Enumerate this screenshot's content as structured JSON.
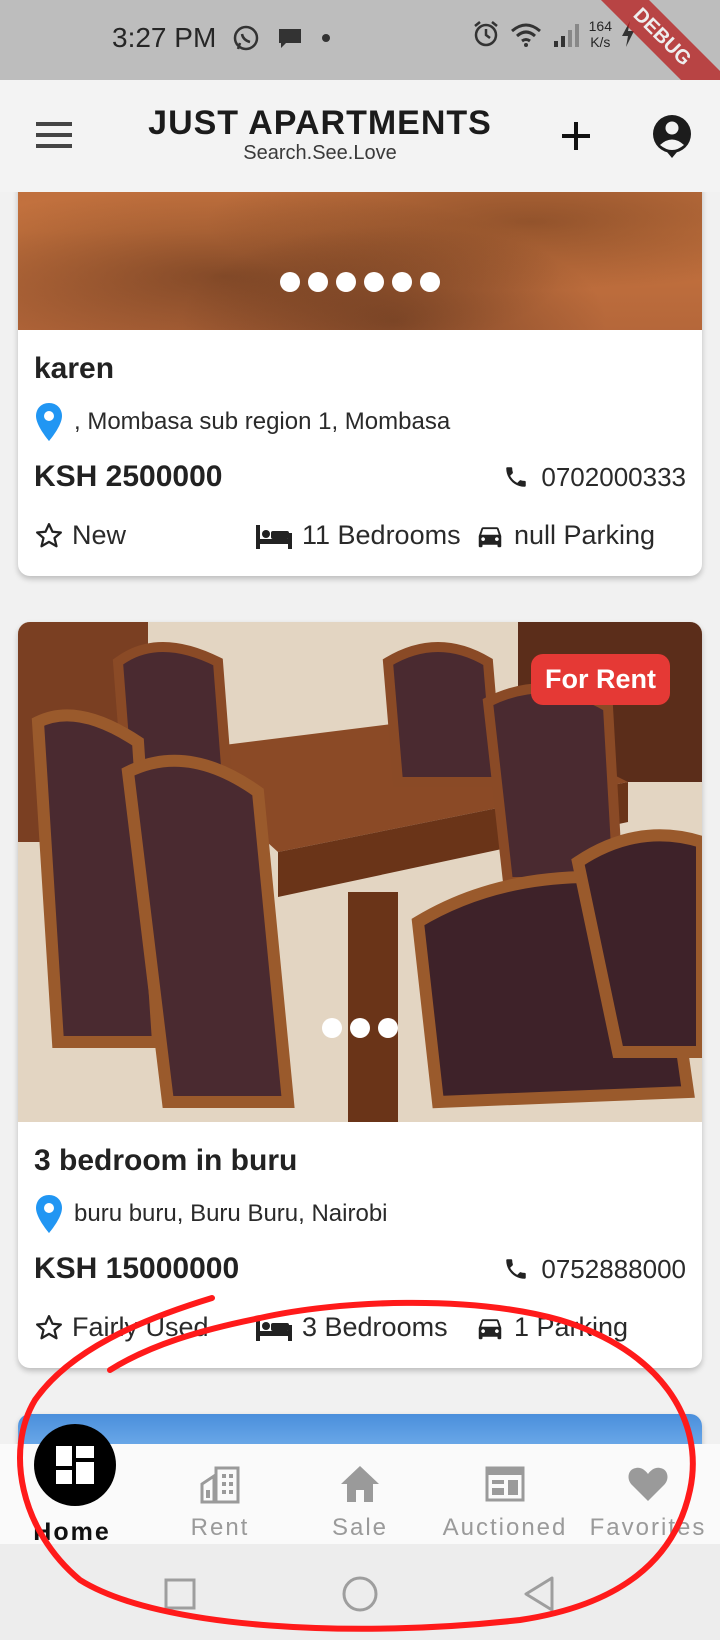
{
  "status_bar": {
    "time": "3:27 PM",
    "speed_value": "164",
    "speed_unit": "K/s",
    "debug_label": "DEBUG",
    "icons": [
      "whatsapp-icon",
      "message-icon",
      "dot-icon",
      "alarm-icon",
      "wifi-icon",
      "signal-icon",
      "charging-icon"
    ]
  },
  "app_bar": {
    "title": "JUST APARTMENTS",
    "subtitle": "Search.See.Love",
    "icons": [
      "menu-icon",
      "add-icon",
      "account-icon"
    ]
  },
  "listings": [
    {
      "title": "karen",
      "location": ", Mombasa sub region 1, Mombasa",
      "price": "KSH 2500000",
      "phone": "0702000333",
      "condition": "New",
      "bedrooms": "11 Bedrooms",
      "parking": "null Parking",
      "badge": "",
      "image_dots": 6
    },
    {
      "title": "3 bedroom in buru",
      "location": "buru buru, Buru Buru, Nairobi",
      "price": "KSH 15000000",
      "phone": "0752888000",
      "condition": "Fairly Used",
      "bedrooms": "3 Bedrooms",
      "parking": "1 Parking",
      "badge": "For Rent",
      "image_dots": 3
    }
  ],
  "bottom_nav": {
    "items": [
      {
        "label": "Home",
        "icon": "dashboard-icon",
        "active": true
      },
      {
        "label": "Rent",
        "icon": "building-icon",
        "active": false
      },
      {
        "label": "Sale",
        "icon": "house-icon",
        "active": false
      },
      {
        "label": "Auctioned",
        "icon": "auction-icon",
        "active": false
      },
      {
        "label": "Favorites",
        "icon": "heart-icon",
        "active": false
      }
    ]
  },
  "colors": {
    "accent_red": "#e53935",
    "location_pin": "#2196f3",
    "annotation_red": "#ff1a1a",
    "status_bar_bg": "#bdbdbd"
  }
}
